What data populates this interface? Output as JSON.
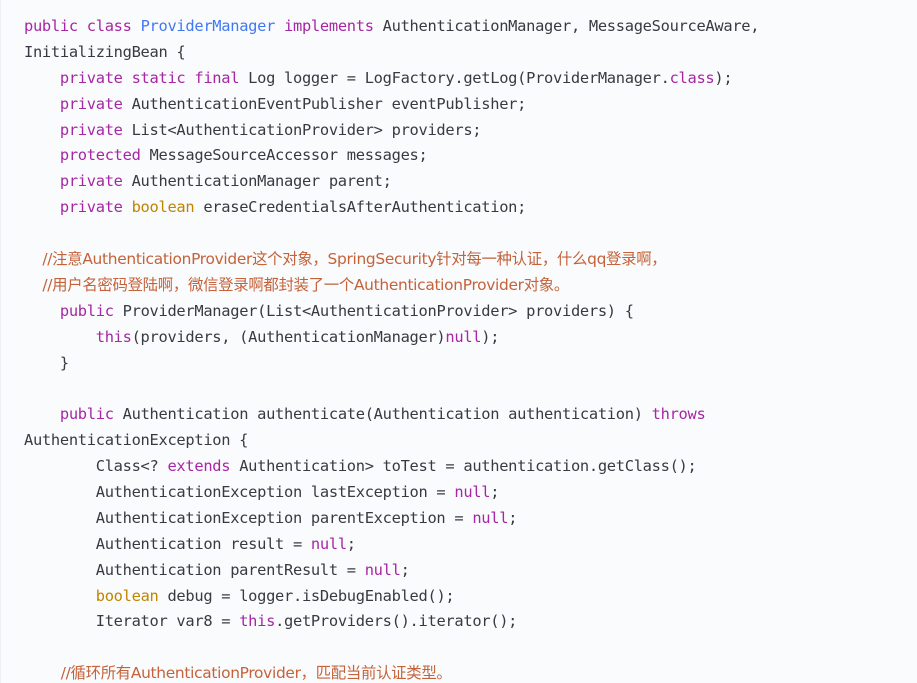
{
  "colors": {
    "keyword": "#a626a4",
    "type_keyword": "#c18401",
    "class_name": "#4078f2",
    "literal": "#986801",
    "comment": "#c4623a",
    "text": "#383a42",
    "background": "#fafbfc"
  },
  "code": {
    "lines": [
      [
        {
          "t": "public class ",
          "c": "kw"
        },
        {
          "t": "ProviderManager",
          "c": "cls"
        },
        {
          "t": " implements ",
          "c": "kw"
        },
        {
          "t": "AuthenticationManager, MessageSourceAware,",
          "c": "tx"
        }
      ],
      [
        {
          "t": "InitializingBean {",
          "c": "tx"
        }
      ],
      [
        {
          "t": "    private static final ",
          "c": "kw"
        },
        {
          "t": "Log logger = LogFactory.getLog(ProviderManager.",
          "c": "tx"
        },
        {
          "t": "class",
          "c": "kw"
        },
        {
          "t": ");",
          "c": "tx"
        }
      ],
      [
        {
          "t": "    private ",
          "c": "kw"
        },
        {
          "t": "AuthenticationEventPublisher eventPublisher;",
          "c": "tx"
        }
      ],
      [
        {
          "t": "    private ",
          "c": "kw"
        },
        {
          "t": "List<AuthenticationProvider> providers;",
          "c": "tx"
        }
      ],
      [
        {
          "t": "    protected ",
          "c": "kw"
        },
        {
          "t": "MessageSourceAccessor messages;",
          "c": "tx"
        }
      ],
      [
        {
          "t": "    private ",
          "c": "kw"
        },
        {
          "t": "AuthenticationManager parent;",
          "c": "tx"
        }
      ],
      [
        {
          "t": "    private ",
          "c": "kw"
        },
        {
          "t": "boolean",
          "c": "ty"
        },
        {
          "t": " eraseCredentialsAfterAuthentication;",
          "c": "tx"
        }
      ],
      [],
      [
        {
          "t": "    //注意AuthenticationProvider这个对象，SpringSecurity针对每一种认证，什么qq登录啊，",
          "c": "zh"
        }
      ],
      [
        {
          "t": "    //用户名密码登陆啊，微信登录啊都封装了一个AuthenticationProvider对象。",
          "c": "zh"
        }
      ],
      [
        {
          "t": "    public ",
          "c": "kw"
        },
        {
          "t": "ProviderManager(List<AuthenticationProvider> providers) {",
          "c": "tx"
        }
      ],
      [
        {
          "t": "        this",
          "c": "kw"
        },
        {
          "t": "(providers, (AuthenticationManager)",
          "c": "tx"
        },
        {
          "t": "null",
          "c": "kw"
        },
        {
          "t": ");",
          "c": "tx"
        }
      ],
      [
        {
          "t": "    }",
          "c": "tx"
        }
      ],
      [],
      [
        {
          "t": "    public ",
          "c": "kw"
        },
        {
          "t": "Authentication authenticate(Authentication authentication) ",
          "c": "tx"
        },
        {
          "t": "throws",
          "c": "kw"
        }
      ],
      [
        {
          "t": "AuthenticationException {",
          "c": "tx"
        }
      ],
      [
        {
          "t": "        Class<? ",
          "c": "tx"
        },
        {
          "t": "extends",
          "c": "kw"
        },
        {
          "t": " Authentication> toTest = authentication.getClass();",
          "c": "tx"
        }
      ],
      [
        {
          "t": "        AuthenticationException lastException = ",
          "c": "tx"
        },
        {
          "t": "null",
          "c": "kw"
        },
        {
          "t": ";",
          "c": "tx"
        }
      ],
      [
        {
          "t": "        AuthenticationException parentException = ",
          "c": "tx"
        },
        {
          "t": "null",
          "c": "kw"
        },
        {
          "t": ";",
          "c": "tx"
        }
      ],
      [
        {
          "t": "        Authentication result = ",
          "c": "tx"
        },
        {
          "t": "null",
          "c": "kw"
        },
        {
          "t": ";",
          "c": "tx"
        }
      ],
      [
        {
          "t": "        Authentication parentResult = ",
          "c": "tx"
        },
        {
          "t": "null",
          "c": "kw"
        },
        {
          "t": ";",
          "c": "tx"
        }
      ],
      [
        {
          "t": "        ",
          "c": "tx"
        },
        {
          "t": "boolean",
          "c": "ty"
        },
        {
          "t": " debug = logger.isDebugEnabled();",
          "c": "tx"
        }
      ],
      [
        {
          "t": "        Iterator var8 = ",
          "c": "tx"
        },
        {
          "t": "this",
          "c": "kw"
        },
        {
          "t": ".getProviders().iterator();",
          "c": "tx"
        }
      ],
      [],
      [
        {
          "t": "        //循环所有AuthenticationProvider，匹配当前认证类型。",
          "c": "zh"
        }
      ]
    ]
  }
}
